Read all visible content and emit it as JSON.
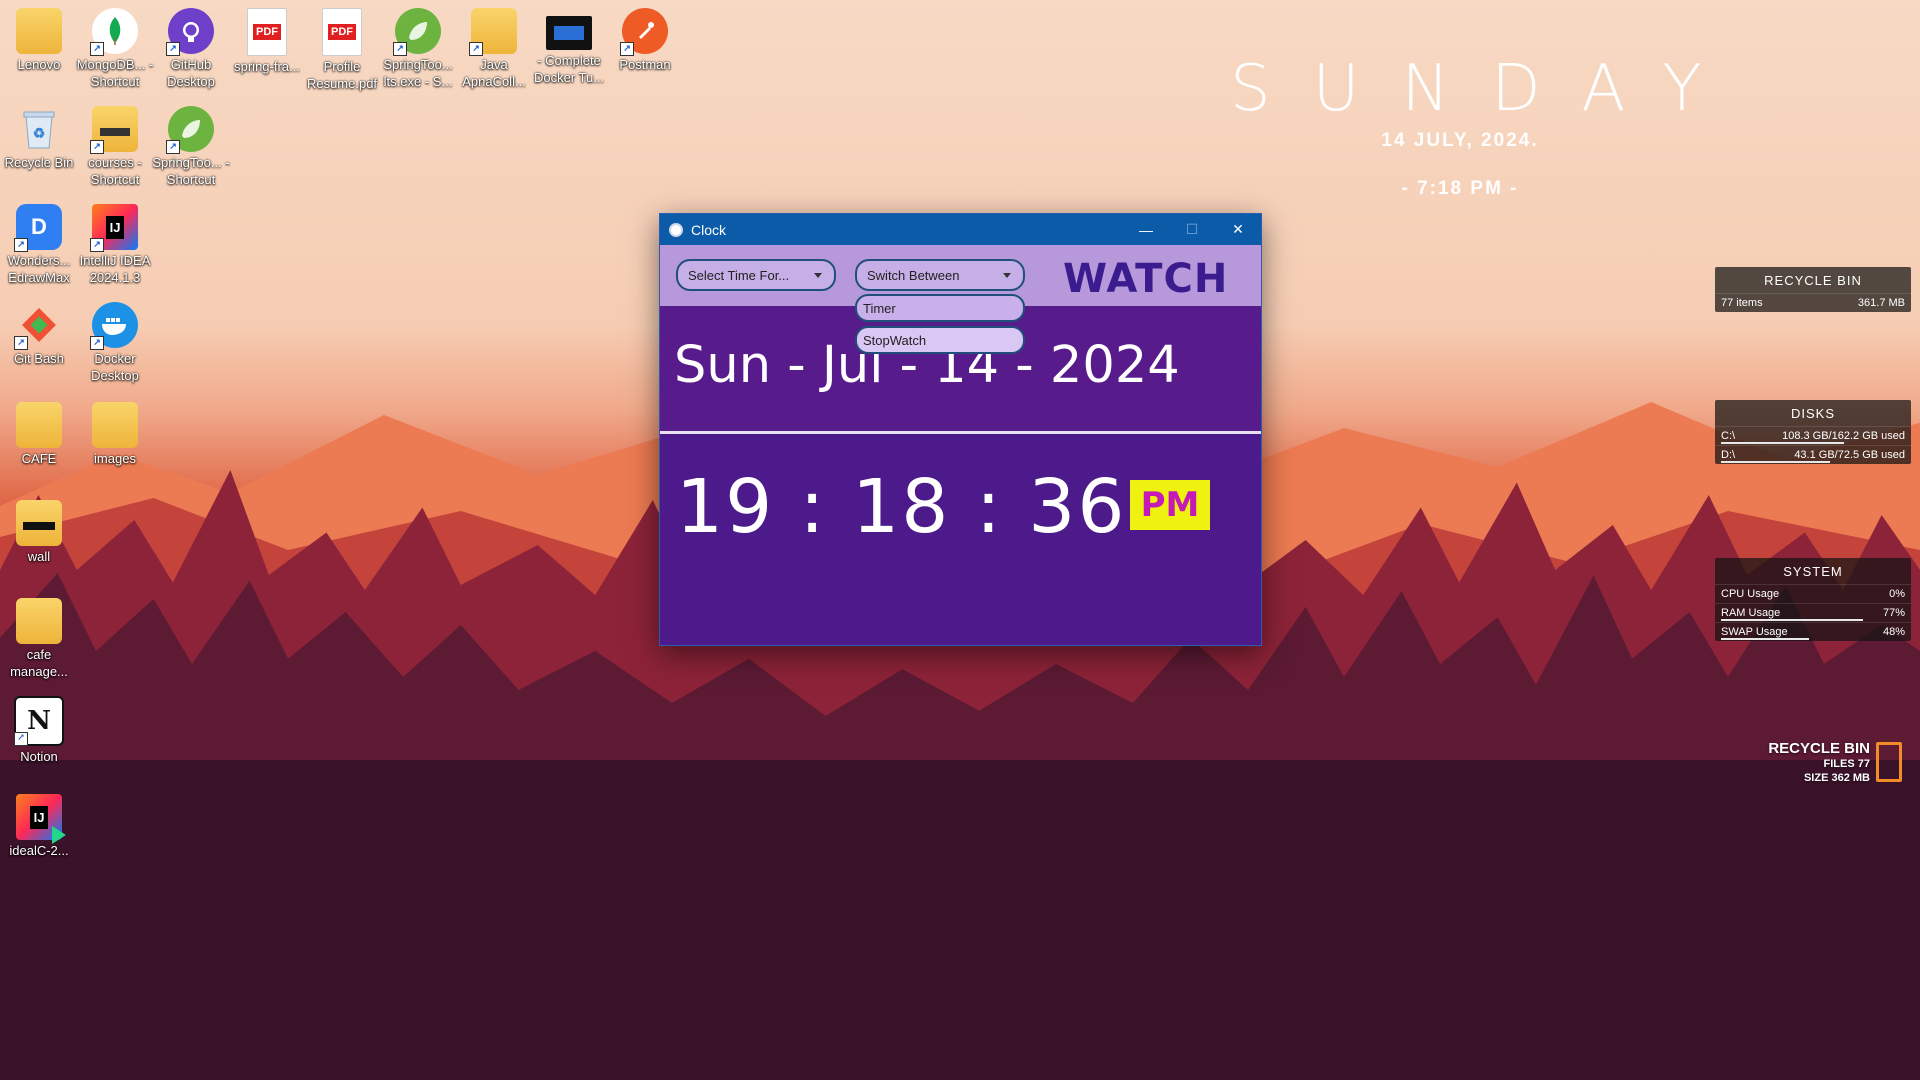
{
  "desktop": {
    "icons": [
      {
        "label": "Lenovo",
        "icon": "folder-icon"
      },
      {
        "label": "MongoDB... - Shortcut",
        "icon": "mongodb-icon"
      },
      {
        "label": "GitHub Desktop",
        "icon": "github-icon"
      },
      {
        "label": "spring-fra...",
        "icon": "pdf-icon"
      },
      {
        "label": "Profile Resume.pdf",
        "icon": "pdf-icon"
      },
      {
        "label": "SpringToo... lts.exe - S...",
        "icon": "spring-icon"
      },
      {
        "label": "Java ApnaColl...",
        "icon": "folder-icon"
      },
      {
        "label": "- Complete Docker Tu...",
        "icon": "video-icon"
      },
      {
        "label": "Postman",
        "icon": "postman-icon"
      },
      {
        "label": "Recycle Bin",
        "icon": "recycle-bin-icon"
      },
      {
        "label": "courses - Shortcut",
        "icon": "folder-icon"
      },
      {
        "label": "SpringToo... - Shortcut",
        "icon": "spring-icon"
      },
      {
        "label": "Wonders... EdrawMax",
        "icon": "edrawmax-icon"
      },
      {
        "label": "IntelliJ IDEA 2024.1.3",
        "icon": "intellij-icon"
      },
      {
        "label": "Git Bash",
        "icon": "git-icon"
      },
      {
        "label": "Docker Desktop",
        "icon": "docker-icon"
      },
      {
        "label": "CAFE",
        "icon": "folder-icon"
      },
      {
        "label": "images",
        "icon": "folder-icon"
      },
      {
        "label": "wall",
        "icon": "folder-icon"
      },
      {
        "label": "cafe manage...",
        "icon": "folder-icon"
      },
      {
        "label": "Notion",
        "icon": "notion-icon"
      },
      {
        "label": "idealC-2...",
        "icon": "intellij-icon"
      }
    ]
  },
  "day_widget": {
    "day": "SUNDAY",
    "date": "14 JULY, 2024.",
    "time": "- 7:18 PM -"
  },
  "recycle_panel": {
    "title": "RECYCLE BIN",
    "items": "77 items",
    "size": "361.7 MB"
  },
  "disks_panel": {
    "title": "DISKS",
    "rows": [
      {
        "drive": "C:\\",
        "usage": "108.3 GB/162.2 GB used",
        "fill": 0.67
      },
      {
        "drive": "D:\\",
        "usage": "43.1 GB/72.5 GB used",
        "fill": 0.59
      }
    ]
  },
  "system_panel": {
    "title": "SYSTEM",
    "rows": [
      {
        "label": "CPU Usage",
        "value": "0%",
        "fill": 0.0
      },
      {
        "label": "RAM Usage",
        "value": "77%",
        "fill": 0.77
      },
      {
        "label": "SWAP Usage",
        "value": "48%",
        "fill": 0.48
      }
    ]
  },
  "recycle_widget": {
    "title": "RECYCLE BIN",
    "files": "FILES 77",
    "size": "SIZE 362 MB"
  },
  "clock_window": {
    "title": "Clock",
    "select_time_label": "Select Time For...",
    "switch_label": "Switch Between",
    "heading": "WATCH",
    "date": "Sun - Jul - 14 - 2024",
    "time": "19 : 18 : 36",
    "ampm": "PM",
    "dropdown_options": [
      "Timer",
      "StopWatch"
    ]
  },
  "colors": {
    "titlebar": "#0b5ba8",
    "toolbar": "#b698db",
    "body": "#4c1a8a",
    "ampm_bg": "#eef20e",
    "ampm_fg": "#c41ab8"
  }
}
